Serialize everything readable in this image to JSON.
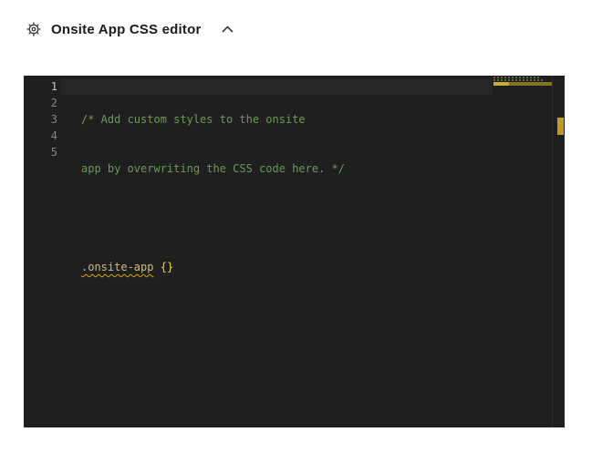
{
  "header": {
    "title": "Onsite App CSS editor",
    "gear_icon": "gear-icon",
    "collapse_icon": "chevron-up-icon"
  },
  "editor": {
    "language": "css",
    "active_line": 1,
    "lines": [
      {
        "number": "1",
        "comment": "/* Add custom styles to the onsite"
      },
      {
        "number": "2",
        "comment": "app by overwriting the CSS code here. */"
      },
      {
        "number": "3"
      },
      {
        "number": "4",
        "selector": ".onsite-app",
        "space": " ",
        "brackets": "{}"
      },
      {
        "number": "5"
      }
    ],
    "warning": {
      "line": 4,
      "squiggle_under": ".onsite-app"
    },
    "palette": {
      "background": "#1f1f1f",
      "comment": "#6a9955",
      "selector": "#d7ba7d",
      "bracket": "#ffd700",
      "line_number": "#858585",
      "line_number_active": "#c6c6c6",
      "current_line_highlight": "#272727",
      "squiggle": "#d7a600",
      "overview_warning_marker": "#bf9b26",
      "minimap_comment": "#55713f",
      "minimap_warning": "#857426"
    }
  }
}
